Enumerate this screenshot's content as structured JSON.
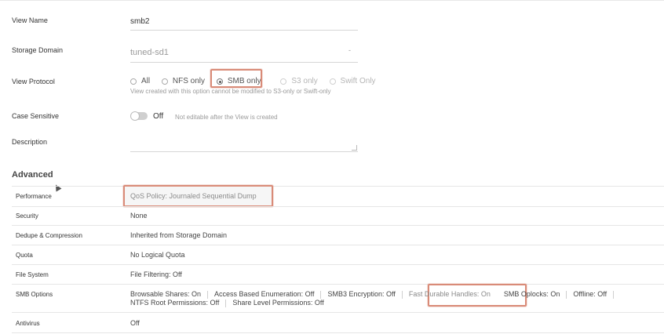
{
  "form": {
    "view_name": {
      "label": "View Name",
      "value": "smb2"
    },
    "storage_domain": {
      "label": "Storage Domain",
      "value": "tuned-sd1",
      "chevron": "-"
    },
    "view_protocol": {
      "label": "View Protocol",
      "options": [
        {
          "label": "All",
          "selected": false,
          "disabled": false
        },
        {
          "label": "NFS only",
          "selected": false,
          "disabled": false
        },
        {
          "label": "SMB only",
          "selected": true,
          "disabled": false
        },
        {
          "label": "S3 only",
          "selected": false,
          "disabled": true
        },
        {
          "label": "Swift Only",
          "selected": false,
          "disabled": true
        }
      ],
      "hint": "View created with this option cannot be modified to S3-only or Swift-only"
    },
    "case_sensitive": {
      "label": "Case Sensitive",
      "state": "Off",
      "note": "Not editable after the View is created"
    },
    "description": {
      "label": "Description",
      "value": ""
    }
  },
  "advanced": {
    "title": "Advanced",
    "rows": [
      {
        "label": "Performance",
        "value": "QoS Policy: Journaled Sequential Dump"
      },
      {
        "label": "Security",
        "value": "None"
      },
      {
        "label": "Dedupe & Compression",
        "value": "Inherited from Storage Domain"
      },
      {
        "label": "Quota",
        "value": "No Logical Quota"
      },
      {
        "label": "File System",
        "value": "File Filtering: Off"
      },
      {
        "label": "SMB Options",
        "items": [
          "Browsable Shares: On",
          "Access Based Enumeration: Off",
          "SMB3 Encryption: Off",
          "Fast Durable Handles: On",
          "SMB Oplocks: On",
          "Offline: Off",
          "NTFS Root Permissions: Off",
          "Share Level Permissions: Off"
        ]
      },
      {
        "label": "Antivirus",
        "value": "Off"
      }
    ]
  },
  "colors": {
    "highlight": "#d98b78",
    "field_line": "#d6d6d6"
  },
  "icons": {
    "cursor": "mouse-pointer-icon",
    "resize": "textarea-resize-icon"
  }
}
